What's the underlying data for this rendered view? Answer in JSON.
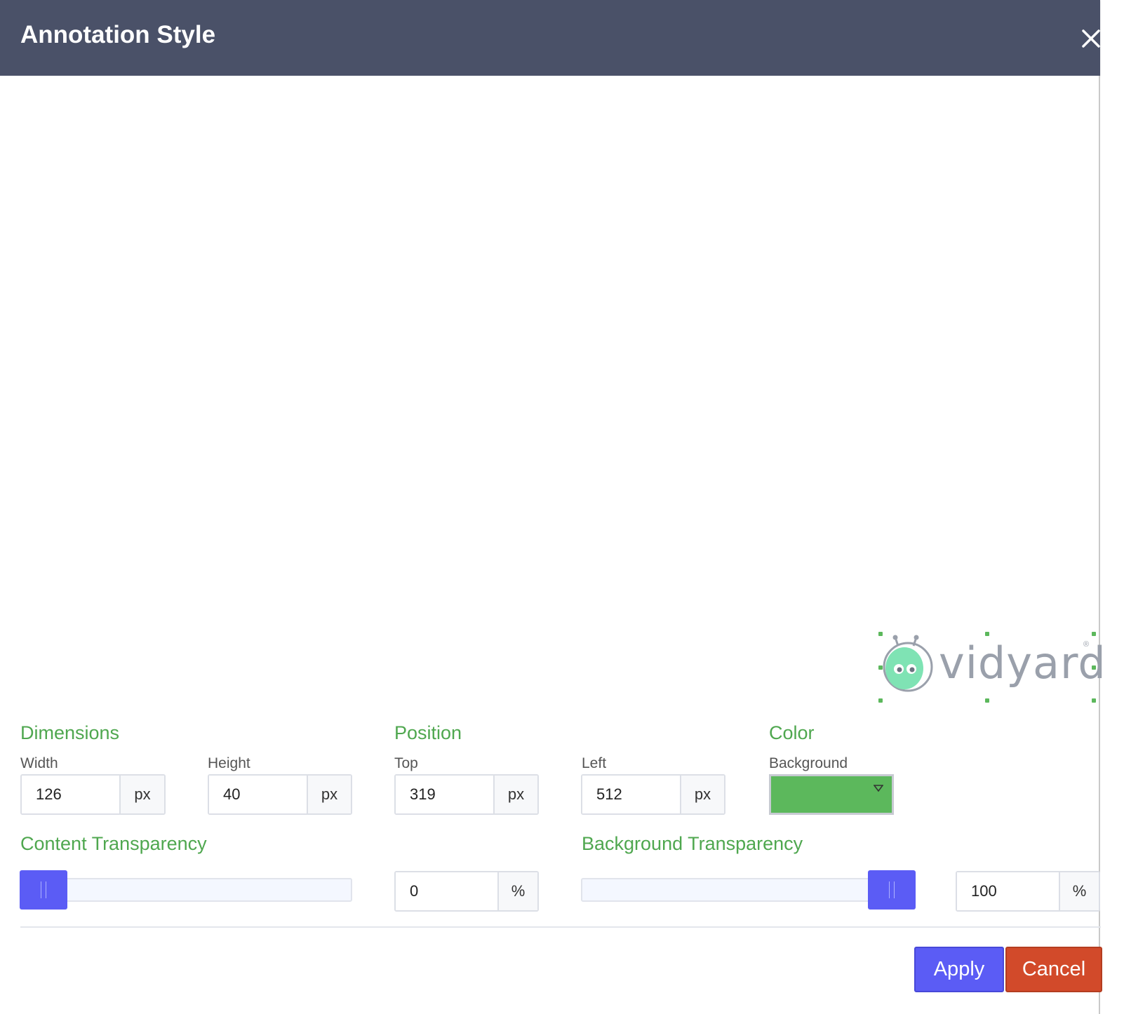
{
  "header": {
    "title": "Annotation Style",
    "close_icon": "close-icon"
  },
  "logo": {
    "text": "vidyard",
    "mark": "®",
    "icon": "vidyard-robot-logo-icon"
  },
  "dimensions": {
    "title": "Dimensions",
    "width_label": "Width",
    "width_value": "126",
    "width_unit": "px",
    "height_label": "Height",
    "height_value": "40",
    "height_unit": "px"
  },
  "position": {
    "title": "Position",
    "top_label": "Top",
    "top_value": "319",
    "top_unit": "px",
    "left_label": "Left",
    "left_value": "512",
    "left_unit": "px"
  },
  "color": {
    "title": "Color",
    "background_label": "Background",
    "background_value": "#5cb85c",
    "dropdown_icon": "caret-down-icon"
  },
  "content_transparency": {
    "title": "Content Transparency",
    "value": "0",
    "unit": "%",
    "level": 0
  },
  "background_transparency": {
    "title": "Background Transparency",
    "value": "100",
    "unit": "%",
    "level": 1
  },
  "footer": {
    "apply_label": "Apply",
    "cancel_label": "Cancel"
  },
  "colors": {
    "header_bg": "#4a5168",
    "accent_green": "#4fa74f",
    "primary": "#5b5cf5",
    "danger": "#d24a2a"
  }
}
